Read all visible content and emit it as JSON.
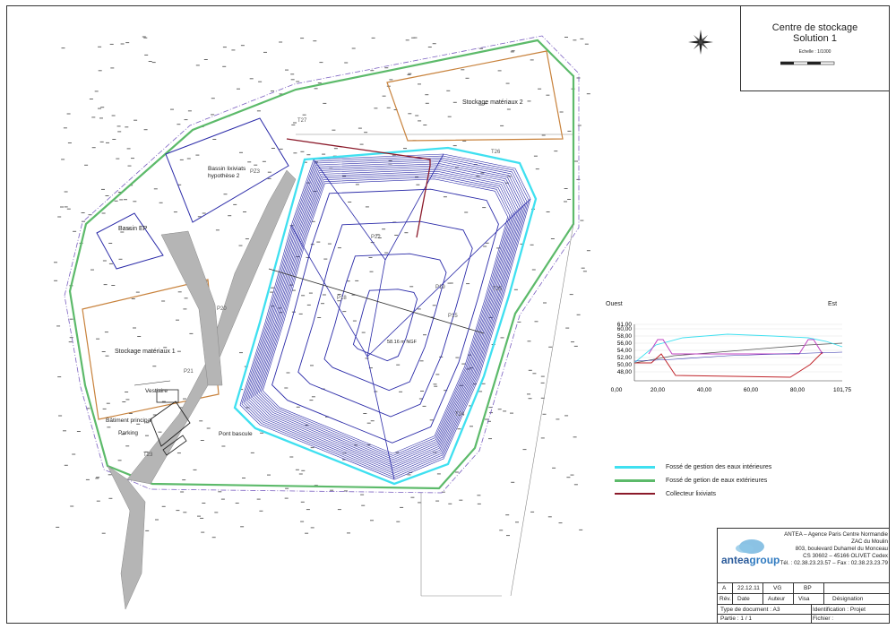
{
  "title_block": {
    "title": "Centre de stockage",
    "subtitle": "Solution 1",
    "scale_label": "Echelle : 1/1000"
  },
  "map_labels": {
    "stockage_2": "Stockage matériaux 2",
    "stockage_1": "Stockage matériaux 1",
    "bassin_lixiviats": "Bassin lixiviats",
    "bassin_hypothese": "hypothèse 2",
    "bassin_ep": "Bassin EP",
    "vestiaire": "Vestiaire",
    "batiment": "Bâtiment principal",
    "parking": "Parking",
    "pont_bascule": "Pont bascule",
    "niveau": "58.16 m NGF",
    "pz3": "PZ3",
    "p18": "P18",
    "p19": "P19",
    "p15": "P15",
    "p20": "P20",
    "p21": "P21",
    "t27": "T27",
    "t26": "T26",
    "t25": "T25",
    "t24": "T24",
    "t23": "T23",
    "p22": "P22"
  },
  "profile": {
    "west": "Ouest",
    "east": "Est",
    "y_ticks": [
      "61,00",
      "60,00",
      "58,00",
      "56,00",
      "54,00",
      "52,00",
      "50,00",
      "48,00"
    ],
    "x_ticks": [
      "0,00",
      "20,00",
      "40,00",
      "60,00",
      "80,00",
      "101,75"
    ]
  },
  "legend": {
    "items": [
      {
        "label": "Fossé de gestion des eaux intérieures",
        "color": "#3fe0f0"
      },
      {
        "label": "Fossé de getion de eaux extérieures",
        "color": "#5cba6a"
      },
      {
        "label": "Collecteur lixiviats",
        "color": "#8b1a2a"
      }
    ]
  },
  "cartouche": {
    "logo_text_antea": "antea",
    "logo_text_group": "group",
    "company": "ANTEA – Agence Paris Centre Normandie",
    "address1": "ZAC du Moulin",
    "address2": "803, boulevard Duhamel du Monceau",
    "address3": "CS 30602 – 45166 OLIVET Cedex",
    "phone": "Tél. : 02.38.23.23.57 – Fax : 02.38.23.23.79",
    "rev_value": "A",
    "date_value": "22.12.11",
    "author_value": "VG",
    "visa_value": "BP",
    "rev_label": "Rév.",
    "date_label": "Date",
    "author_label": "Auteur",
    "visa_label": "Visa",
    "designation_label": "Désignation",
    "doc_type": "Type de document : A3",
    "identification": "Identification : Projet",
    "partie": "Partie : 1 / 1",
    "fichier": "Fichier :"
  },
  "colors": {
    "inner_ditch": "#3fe0f0",
    "outer_ditch": "#5cba6a",
    "collector": "#8b1a2a",
    "cell_lines": "#2a2aa8",
    "storage": "#c8823c",
    "road": "#b5b5b5"
  }
}
